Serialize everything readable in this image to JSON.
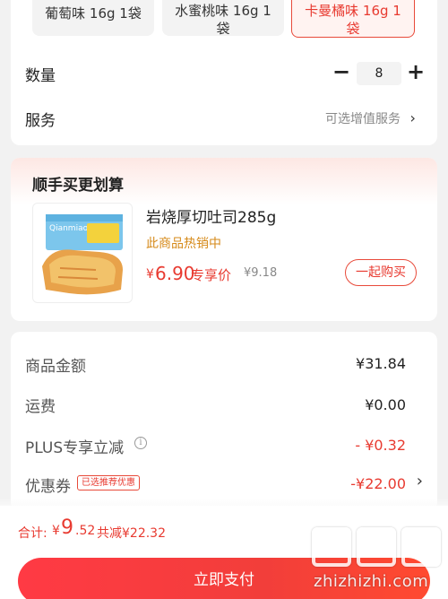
{
  "variants": [
    {
      "label": "葡萄味 16g 1袋",
      "selected": false,
      "color": "#b98de0"
    },
    {
      "label": "水蜜桃味 16g 1 袋",
      "selected": false,
      "color": "#f4a98a"
    },
    {
      "label": "卡曼橘味 16g 1 袋",
      "selected": true,
      "color": "#f7b9a8"
    }
  ],
  "quantity": {
    "label": "数量",
    "minus_symbol": "−",
    "value": "8",
    "plus_symbol": "+"
  },
  "service": {
    "label": "服务",
    "value": "可选增值服务",
    "chevron": "›"
  },
  "addon": {
    "title": "顺手买更划算",
    "product": {
      "name": "岩烧厚切吐司285g",
      "hot_label": "此商品热销中",
      "price_symbol": "¥",
      "price": "6.90",
      "price_tag": "专享价",
      "original_price": "¥9.18",
      "buy_label": "一起购买",
      "image_brand": "Qianmiao"
    }
  },
  "summary": {
    "rows": [
      {
        "label": "商品金额",
        "value": "¥31.84"
      },
      {
        "label": "运费",
        "value": "¥0.00"
      },
      {
        "label": "PLUS专享立减",
        "value": "- ¥0.32"
      },
      {
        "label": "优惠券",
        "value": "-¥22.00",
        "tag": "已选推荐优惠",
        "chevron": "›"
      }
    ],
    "info_icon_glyph": "i"
  },
  "footer": {
    "total_label": "合计:",
    "currency": "¥",
    "total_integer": "9",
    "total_decimal": ".52",
    "saving": "共减¥22.32",
    "pay_label": "立即支付"
  },
  "watermark": {
    "text": "zhizhizhi.com"
  },
  "colors": {
    "accent": "#e83a30",
    "hot": "#d68a1a",
    "pay_button": "#f23e3a"
  }
}
